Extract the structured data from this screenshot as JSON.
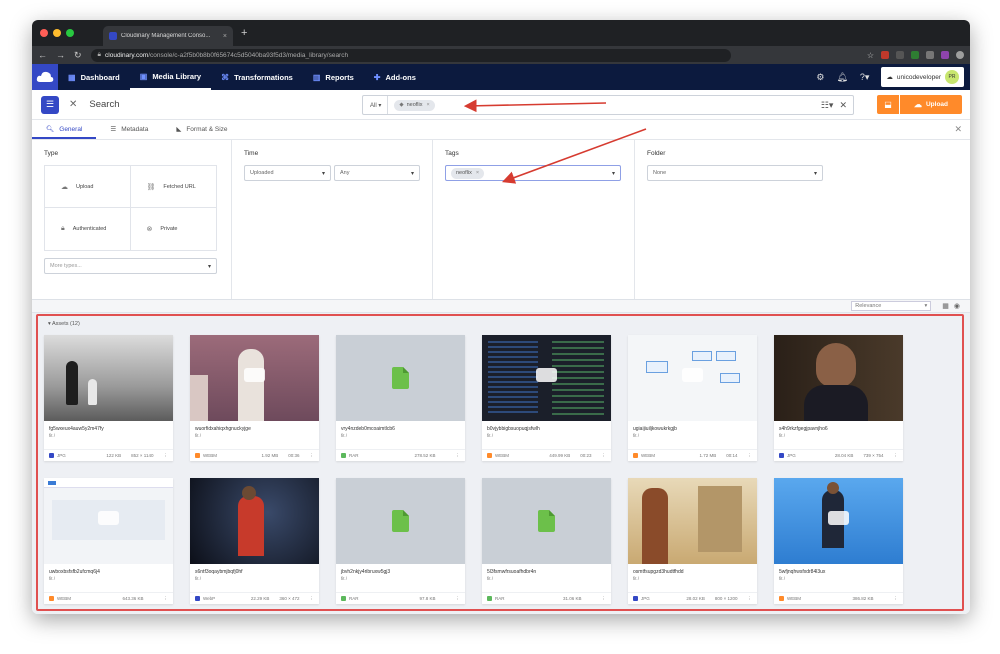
{
  "browser": {
    "tab_title": "Cloudinary Management Conso...",
    "tab_close": "×",
    "new_tab": "+",
    "url_domain": "cloudinary.com",
    "url_path": "/console/c-a2f5b0b8b0f65674c5d5040ba93f5d3/media_library/search"
  },
  "appnav": {
    "items": [
      {
        "label": "Dashboard",
        "icon": "▦"
      },
      {
        "label": "Media Library",
        "icon": "▣"
      },
      {
        "label": "Transformations",
        "icon": "⌘"
      },
      {
        "label": "Reports",
        "icon": "▥"
      },
      {
        "label": "Add-ons",
        "icon": "✚"
      }
    ],
    "account_name": "unicodeveloper",
    "avatar_initials": "PR"
  },
  "search": {
    "label": "Search",
    "scope": "All ▾",
    "chip": "neoflix",
    "upload_label": "Upload"
  },
  "tabs": [
    "General",
    "Metadata",
    "Format & Size"
  ],
  "filters": {
    "type": {
      "title": "Type",
      "options": [
        "Upload",
        "Fetched URL",
        "Authenticated",
        "Private"
      ],
      "more_placeholder": "More types..."
    },
    "time": {
      "title": "Time",
      "field": "Uploaded",
      "value": "Any"
    },
    "tags": {
      "title": "Tags",
      "chip": "neoflix"
    },
    "folder": {
      "title": "Folder",
      "value": "None"
    }
  },
  "results": {
    "sort_label": "Relevance",
    "section_label": "Assets (12)",
    "cards": [
      {
        "name": "fg5wxeux4auw5y2m47fy",
        "meta": "fit /",
        "fmt": "JPG",
        "size": "122 KB",
        "dims": "852 × 1140",
        "badge": "#3448c5"
      },
      {
        "name": "wuorfidxahiqxhgnuckyjge",
        "meta": "fit /",
        "fmt": "WEBM",
        "size": "1.92 MB",
        "dims": "00:36",
        "badge": "#ff8a2a"
      },
      {
        "name": "vry4nzdeb0mcoaimtlcb6",
        "meta": "fit /",
        "fmt": "RAR",
        "size": "278.52 KB",
        "dims": "",
        "badge": "#5cb85c"
      },
      {
        "name": "b0vjybbigbsuopuqjsfwlh",
        "meta": "fit /",
        "fmt": "WEBM",
        "size": "449.99 KB",
        "dims": "00:23",
        "badge": "#ff8a2a"
      },
      {
        "name": "ugiaijiuiljkowukrkgjb",
        "meta": "fit /",
        "fmt": "WEBM",
        "size": "1.72 MB",
        "dims": "00:14",
        "badge": "#ff8a2a"
      },
      {
        "name": "s4h9rkzfgegjpavnjho6",
        "meta": "fit /",
        "fmt": "JPG",
        "size": "28.04 KB",
        "dims": "739 × 754",
        "badge": "#3448c5"
      },
      {
        "name": "uwboxbsfsfb2ufcmq6j4",
        "meta": "fit /",
        "fmt": "WEBM",
        "size": "643.36 KB",
        "dims": "",
        "badge": "#ff8a2a"
      },
      {
        "name": "s6ntf3oqaybmjbqfj0hf",
        "meta": "fit /",
        "fmt": "WebP",
        "size": "22.29 KB",
        "dims": "360 × 472",
        "badge": "#3448c5"
      },
      {
        "name": "jbvh2nkjy4ribruxw5gj3",
        "meta": "fit /",
        "fmt": "RAR",
        "size": "97.8 KB",
        "dims": "",
        "badge": "#5cb85c"
      },
      {
        "name": "5l3fsmwfrsuoafhdbr4n",
        "meta": "fit /",
        "fmt": "RAR",
        "size": "31.06 KB",
        "dims": "",
        "badge": "#5cb85c"
      },
      {
        "name": "osmtfsupgzd3hudtfhdd",
        "meta": "fit /",
        "fmt": "JPG",
        "size": "28.02 KB",
        "dims": "800 × 1200",
        "badge": "#3448c5"
      },
      {
        "name": "5wfjnqhwsfxdr84l3ux",
        "meta": "fit /",
        "fmt": "WEBM",
        "size": "386.82 KB",
        "dims": "",
        "badge": "#ff8a2a"
      }
    ]
  },
  "colors": {
    "accent": "#3448c5",
    "nav_bg": "#0c1a3e",
    "upload": "#ff8a2a",
    "annotation": "#e05050"
  }
}
